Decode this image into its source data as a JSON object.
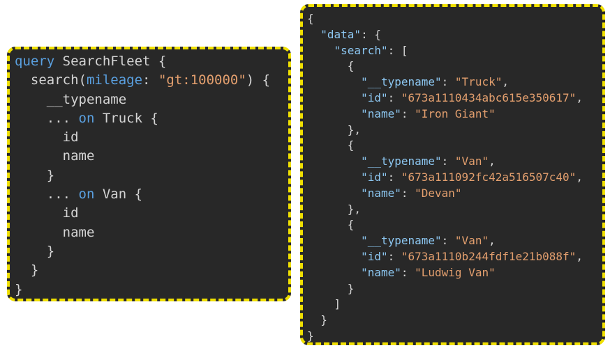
{
  "query_panel": {
    "lines": [
      {
        "indent": "",
        "parts": [
          {
            "t": "query",
            "c": "kw"
          },
          {
            "t": " SearchFleet {",
            "c": "punct"
          }
        ]
      },
      {
        "indent": "  ",
        "parts": [
          {
            "t": "search(",
            "c": "punct"
          },
          {
            "t": "mileage",
            "c": "arg"
          },
          {
            "t": ": ",
            "c": "punct"
          },
          {
            "t": "\"gt:100000\"",
            "c": "str"
          },
          {
            "t": ") {",
            "c": "punct"
          }
        ]
      },
      {
        "indent": "    ",
        "parts": [
          {
            "t": "__typename",
            "c": "punct"
          }
        ]
      },
      {
        "indent": "    ",
        "parts": [
          {
            "t": "... ",
            "c": "punct"
          },
          {
            "t": "on",
            "c": "kw"
          },
          {
            "t": " Truck {",
            "c": "punct"
          }
        ]
      },
      {
        "indent": "      ",
        "parts": [
          {
            "t": "id",
            "c": "punct"
          }
        ]
      },
      {
        "indent": "      ",
        "parts": [
          {
            "t": "name",
            "c": "punct"
          }
        ]
      },
      {
        "indent": "    ",
        "parts": [
          {
            "t": "}",
            "c": "punct"
          }
        ]
      },
      {
        "indent": "    ",
        "parts": [
          {
            "t": "... ",
            "c": "punct"
          },
          {
            "t": "on",
            "c": "kw"
          },
          {
            "t": " Van {",
            "c": "punct"
          }
        ]
      },
      {
        "indent": "      ",
        "parts": [
          {
            "t": "id",
            "c": "punct"
          }
        ]
      },
      {
        "indent": "      ",
        "parts": [
          {
            "t": "name",
            "c": "punct"
          }
        ]
      },
      {
        "indent": "    ",
        "parts": [
          {
            "t": "}",
            "c": "punct"
          }
        ]
      },
      {
        "indent": "  ",
        "parts": [
          {
            "t": "}",
            "c": "punct"
          }
        ]
      },
      {
        "indent": "",
        "parts": [
          {
            "t": "}",
            "c": "punct"
          }
        ]
      }
    ]
  },
  "response_panel": {
    "lines": [
      {
        "indent": "",
        "parts": [
          {
            "t": "{",
            "c": "punct"
          }
        ]
      },
      {
        "indent": "  ",
        "parts": [
          {
            "t": "\"data\"",
            "c": "key"
          },
          {
            "t": ": {",
            "c": "punct"
          }
        ]
      },
      {
        "indent": "    ",
        "parts": [
          {
            "t": "\"search\"",
            "c": "key"
          },
          {
            "t": ": [",
            "c": "punct"
          }
        ]
      },
      {
        "indent": "      ",
        "parts": [
          {
            "t": "{",
            "c": "punct"
          }
        ]
      },
      {
        "indent": "        ",
        "parts": [
          {
            "t": "\"__typename\"",
            "c": "key"
          },
          {
            "t": ": ",
            "c": "punct"
          },
          {
            "t": "\"Truck\"",
            "c": "str"
          },
          {
            "t": ",",
            "c": "punct"
          }
        ]
      },
      {
        "indent": "        ",
        "parts": [
          {
            "t": "\"id\"",
            "c": "key"
          },
          {
            "t": ": ",
            "c": "punct"
          },
          {
            "t": "\"673a1110434abc615e350617\"",
            "c": "str"
          },
          {
            "t": ",",
            "c": "punct"
          }
        ]
      },
      {
        "indent": "        ",
        "parts": [
          {
            "t": "\"name\"",
            "c": "key"
          },
          {
            "t": ": ",
            "c": "punct"
          },
          {
            "t": "\"Iron Giant\"",
            "c": "str"
          }
        ]
      },
      {
        "indent": "      ",
        "parts": [
          {
            "t": "},",
            "c": "punct"
          }
        ]
      },
      {
        "indent": "      ",
        "parts": [
          {
            "t": "{",
            "c": "punct"
          }
        ]
      },
      {
        "indent": "        ",
        "parts": [
          {
            "t": "\"__typename\"",
            "c": "key"
          },
          {
            "t": ": ",
            "c": "punct"
          },
          {
            "t": "\"Van\"",
            "c": "str"
          },
          {
            "t": ",",
            "c": "punct"
          }
        ]
      },
      {
        "indent": "        ",
        "parts": [
          {
            "t": "\"id\"",
            "c": "key"
          },
          {
            "t": ": ",
            "c": "punct"
          },
          {
            "t": "\"673a111092fc42a516507c40\"",
            "c": "str"
          },
          {
            "t": ",",
            "c": "punct"
          }
        ]
      },
      {
        "indent": "        ",
        "parts": [
          {
            "t": "\"name\"",
            "c": "key"
          },
          {
            "t": ": ",
            "c": "punct"
          },
          {
            "t": "\"Devan\"",
            "c": "str"
          }
        ]
      },
      {
        "indent": "      ",
        "parts": [
          {
            "t": "},",
            "c": "punct"
          }
        ]
      },
      {
        "indent": "      ",
        "parts": [
          {
            "t": "{",
            "c": "punct"
          }
        ]
      },
      {
        "indent": "        ",
        "parts": [
          {
            "t": "\"__typename\"",
            "c": "key"
          },
          {
            "t": ": ",
            "c": "punct"
          },
          {
            "t": "\"Van\"",
            "c": "str"
          },
          {
            "t": ",",
            "c": "punct"
          }
        ]
      },
      {
        "indent": "        ",
        "parts": [
          {
            "t": "\"id\"",
            "c": "key"
          },
          {
            "t": ": ",
            "c": "punct"
          },
          {
            "t": "\"673a1110b244fdf1e21b088f\"",
            "c": "str"
          },
          {
            "t": ",",
            "c": "punct"
          }
        ]
      },
      {
        "indent": "        ",
        "parts": [
          {
            "t": "\"name\"",
            "c": "key"
          },
          {
            "t": ": ",
            "c": "punct"
          },
          {
            "t": "\"Ludwig Van\"",
            "c": "str"
          }
        ]
      },
      {
        "indent": "      ",
        "parts": [
          {
            "t": "}",
            "c": "punct"
          }
        ]
      },
      {
        "indent": "    ",
        "parts": [
          {
            "t": "]",
            "c": "punct"
          }
        ]
      },
      {
        "indent": "  ",
        "parts": [
          {
            "t": "}",
            "c": "punct"
          }
        ]
      },
      {
        "indent": "",
        "parts": [
          {
            "t": "}",
            "c": "punct"
          }
        ]
      }
    ]
  },
  "colors": {
    "panel_bg": "#282828",
    "border_dash": "#f0e000",
    "keyword": "#5aa0e0",
    "string": "#e39f6e",
    "json_key": "#8cc6f0",
    "text": "#d4d4d4"
  }
}
